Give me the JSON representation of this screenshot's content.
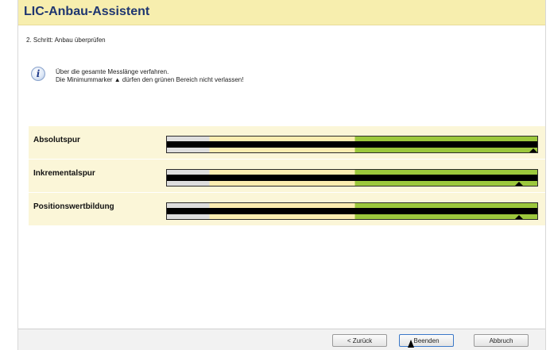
{
  "window": {
    "title": "LIC-Anbau-Assistent"
  },
  "step": {
    "label": "2. Schritt: Anbau überprüfen"
  },
  "info": {
    "icon": "info-icon",
    "line1": "Über die gesamte Messlänge verfahren.",
    "line2": "Die Minimummarker ▲ dürfen den grünen Bereich nicht verlassen!"
  },
  "tracks": [
    {
      "label": "Absolutspur",
      "marker_position": 1.0
    },
    {
      "label": "Inkrementalspur",
      "marker_position": 0.95
    },
    {
      "label": "Positionswertbildung",
      "marker_position": 0.95
    }
  ],
  "colors": {
    "gray_zone": "#dedede",
    "yellow_zone": "#fbedb0",
    "green_zone": "#9cc83c",
    "title_bg": "#f7eeae",
    "title_text": "#1f3670"
  },
  "buttons": {
    "back": "< Zurück",
    "finish": "Beenden",
    "cancel": "Abbruch"
  }
}
